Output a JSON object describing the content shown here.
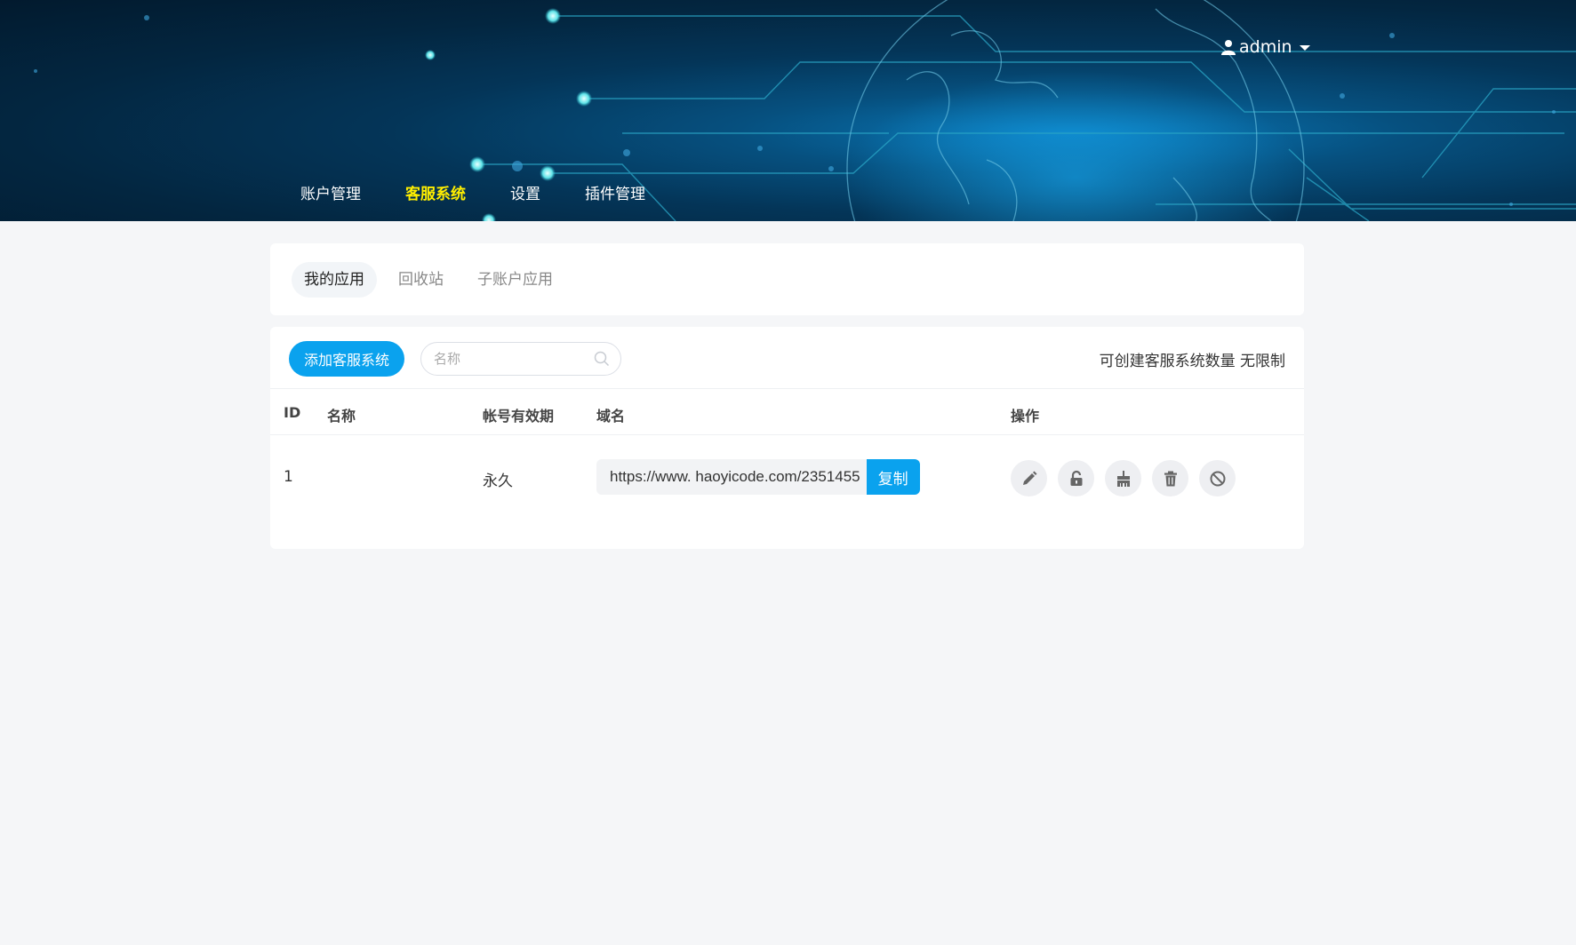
{
  "header": {
    "user": "admin",
    "nav": [
      {
        "label": "账户管理",
        "active": false
      },
      {
        "label": "客服系统",
        "active": true
      },
      {
        "label": "设置",
        "active": false
      },
      {
        "label": "插件管理",
        "active": false
      }
    ]
  },
  "tabs": [
    {
      "label": "我的应用",
      "active": true
    },
    {
      "label": "回收站",
      "active": false
    },
    {
      "label": "子账户应用",
      "active": false
    }
  ],
  "toolbar": {
    "add_label": "添加客服系统",
    "search_placeholder": "名称",
    "quota_label": "可创建客服系统数量",
    "quota_value": "无限制"
  },
  "table": {
    "headers": {
      "id": "ID",
      "name": "名称",
      "expiry": "帐号有效期",
      "domain": "域名",
      "actions": "操作"
    },
    "rows": [
      {
        "id": "1",
        "name": "",
        "expiry": "永久",
        "domain": "https://www. haoyicode.com/2351455",
        "copy_label": "复制"
      }
    ],
    "row_actions": [
      "edit-icon",
      "unlock-icon",
      "broom-icon",
      "trash-icon",
      "ban-icon"
    ]
  },
  "colors": {
    "accent": "#0aa2ee",
    "nav_active": "#ffee00"
  }
}
